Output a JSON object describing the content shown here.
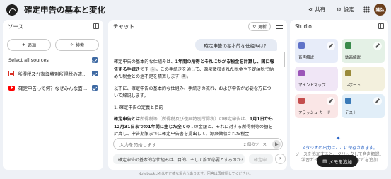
{
  "header": {
    "title": "確定申告の基本と変化",
    "share_label": "共有",
    "settings_label": "設定",
    "avatar_initials": "隆弘"
  },
  "sources": {
    "heading": "ソース",
    "add_label": "追加",
    "search_label": "検索",
    "select_all_label": "Select all sources",
    "items": [
      {
        "name": "所得税及び復興特別所得税の確定申告の手引き",
        "icon": "pdf-icon"
      },
      {
        "name": "確定申告って何？なぜみんな面倒くさがるの？",
        "icon": "youtube-icon"
      }
    ]
  },
  "chat": {
    "heading": "チャット",
    "refresh_label": "更新",
    "user_message": "確定申告の基本的な仕組みは？",
    "answer": {
      "p1_pre": "確定申告の基本的な仕組みは、",
      "p1_bold": "1年間の所得とそれにかかる税金を計算し、国に報告する手続き",
      "p1_post": "です",
      "cite1": "1",
      "p1_rest": "。この手続きを通して、源泉徴収された税金や予定納税で納めた税金との過不足を精算します",
      "cite2": "3",
      "p1_end": "。",
      "p2": "以下に、確定申告の基本的な仕組み、手続きの流れ、および申告が必要な方について解説します。",
      "h1": "1. 確定申告の定義と目的",
      "p3_bold1": "確定申告とは",
      "p3_mid": "所得税等（所得税及び復興特別所得税）の確定申告は、",
      "p3_bold2": "1月1日から12月31日までの1年間に生じた全ての",
      "p3_after": "の金額と、それに対する所得税等の額を計算し",
      "p3_tail": "、申告期限までに確定申告書を提出して、源泉徴収された税金"
    },
    "input_placeholder": "入力を開始します...",
    "source_count": "2 個のソース",
    "suggestions": [
      "確定申告の基本的な仕組みは、目的、そして誰が必要とするのか？",
      "確定申"
    ],
    "footer": "NotebookLM は不正確な場合があります。回答は再確認してください。"
  },
  "studio": {
    "heading": "Studio",
    "cards": [
      {
        "label": "音声解説",
        "bg": "#e7ecf9",
        "icon_color": "#5f72c8"
      },
      {
        "label": "動画解説",
        "bg": "#e4f1e6",
        "icon_color": "#3a8a4b"
      },
      {
        "label": "マインドマップ",
        "bg": "#f0e6f6",
        "icon_color": "#9b55b8"
      },
      {
        "label": "レポート",
        "bg": "#f3f0dd",
        "icon_color": "#9a8a3a"
      },
      {
        "label": "フラッシュ カード",
        "bg": "#fae6e6",
        "icon_color": "#c44d4d"
      },
      {
        "label": "テスト",
        "bg": "#e1eef8",
        "icon_color": "#3a7ab8"
      }
    ],
    "note_title": "スタジオの出力はここに保存されます。",
    "note_body": "ソースを追加すると、クリックして音声解説、学習ガイド、マインドマップなどを追加",
    "add_note_label": "メモを追加"
  }
}
